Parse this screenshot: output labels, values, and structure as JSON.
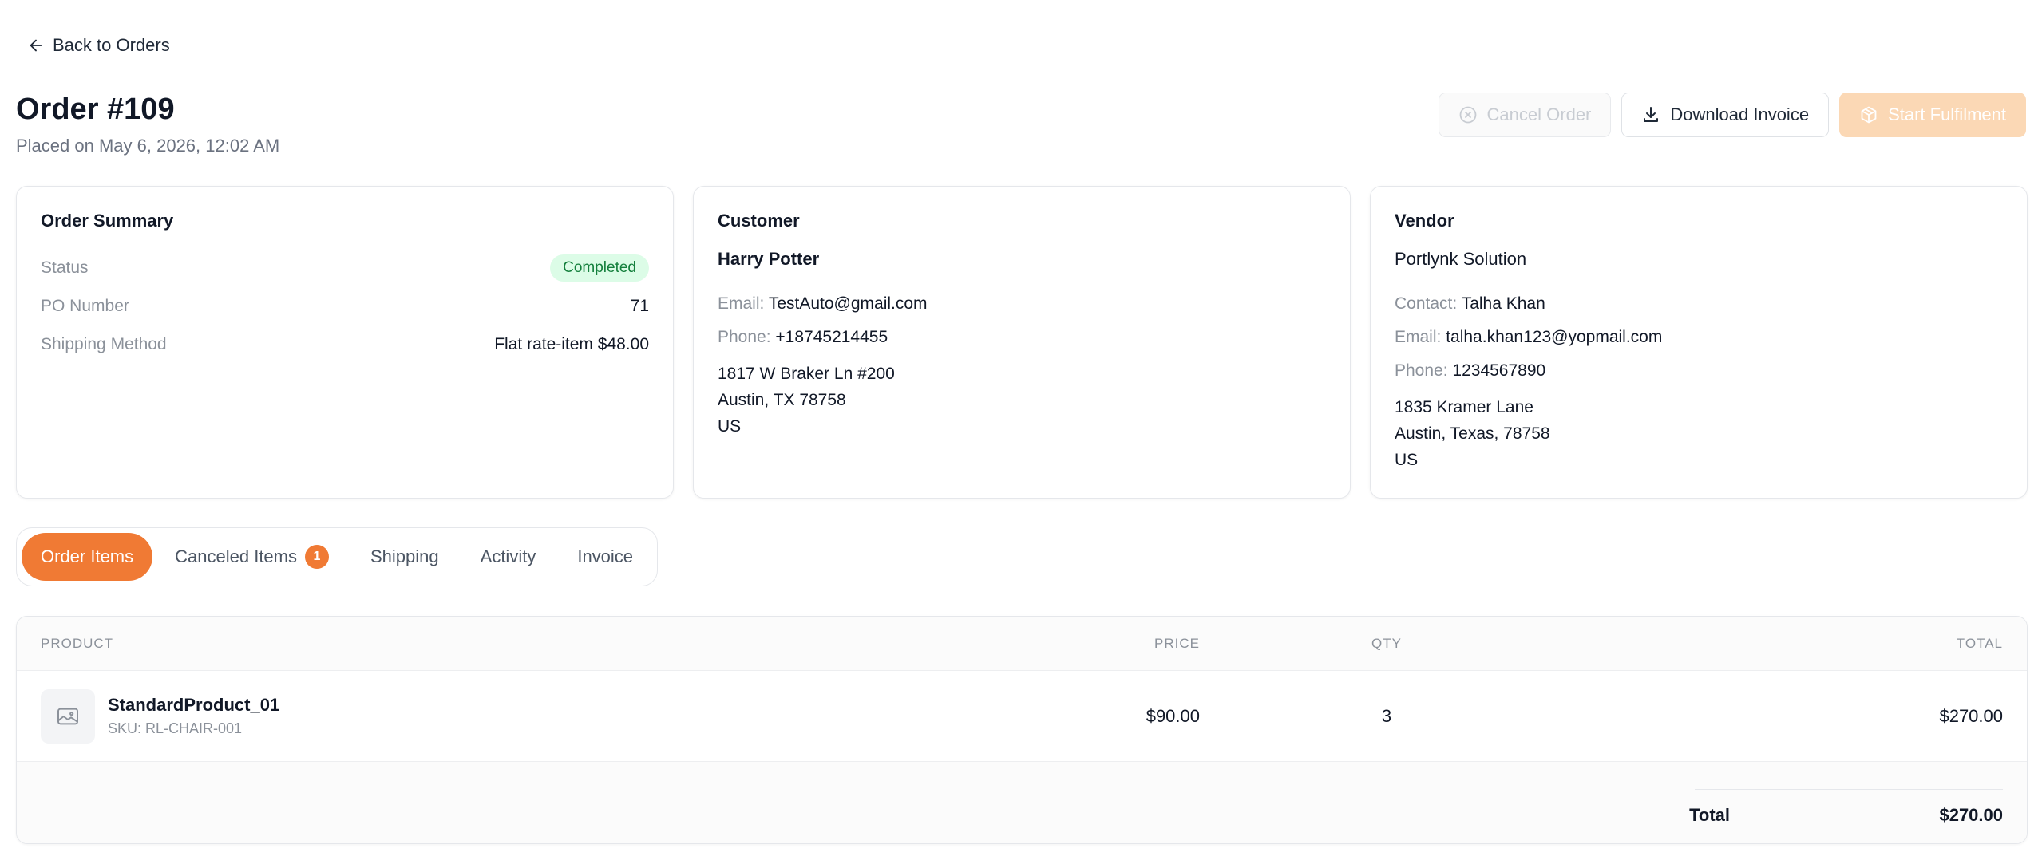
{
  "nav": {
    "back_label": "Back to Orders"
  },
  "header": {
    "title": "Order #109",
    "placed_on": "Placed on May 6, 2026, 12:02 AM"
  },
  "actions": {
    "cancel_label": "Cancel Order",
    "download_label": "Download Invoice",
    "start_label": "Start Fulfilment"
  },
  "summary": {
    "title": "Order Summary",
    "status_label": "Status",
    "status_value": "Completed",
    "po_label": "PO Number",
    "po_value": "71",
    "shipping_label": "Shipping Method",
    "shipping_value": "Flat rate-item $48.00"
  },
  "customer": {
    "title": "Customer",
    "name": "Harry Potter",
    "email_label": "Email:",
    "email": "TestAuto@gmail.com",
    "phone_label": "Phone:",
    "phone": "+18745214455",
    "address_line1": "1817 W Braker Ln #200",
    "address_line2": "Austin, TX 78758",
    "address_line3": "US"
  },
  "vendor": {
    "title": "Vendor",
    "name": "Portlynk Solution",
    "contact_label": "Contact:",
    "contact": "Talha Khan",
    "email_label": "Email:",
    "email": "talha.khan123@yopmail.com",
    "phone_label": "Phone:",
    "phone": "1234567890",
    "address_line1": "1835 Kramer Lane",
    "address_line2": "Austin, Texas, 78758",
    "address_line3": "US"
  },
  "tabs": [
    {
      "label": "Order Items"
    },
    {
      "label": "Canceled Items",
      "count": "1"
    },
    {
      "label": "Shipping"
    },
    {
      "label": "Activity"
    },
    {
      "label": "Invoice"
    }
  ],
  "table": {
    "headers": {
      "product": "PRODUCT",
      "price": "PRICE",
      "qty": "QTY",
      "total": "TOTAL"
    },
    "rows": [
      {
        "name": "StandardProduct_01",
        "sku": "SKU: RL-CHAIR-001",
        "price": "$90.00",
        "qty": "3",
        "total": "$270.00"
      }
    ],
    "footer": {
      "total_label": "Total",
      "total_value": "$270.00"
    }
  },
  "colors": {
    "accent": "#f07a34",
    "status_completed_bg": "#dcfce7",
    "status_completed_text": "#15803d"
  },
  "icons": {
    "back": "arrow-left-icon",
    "cancel": "x-circle-icon",
    "download": "download-icon",
    "start": "package-icon",
    "product": "image-placeholder-icon"
  }
}
